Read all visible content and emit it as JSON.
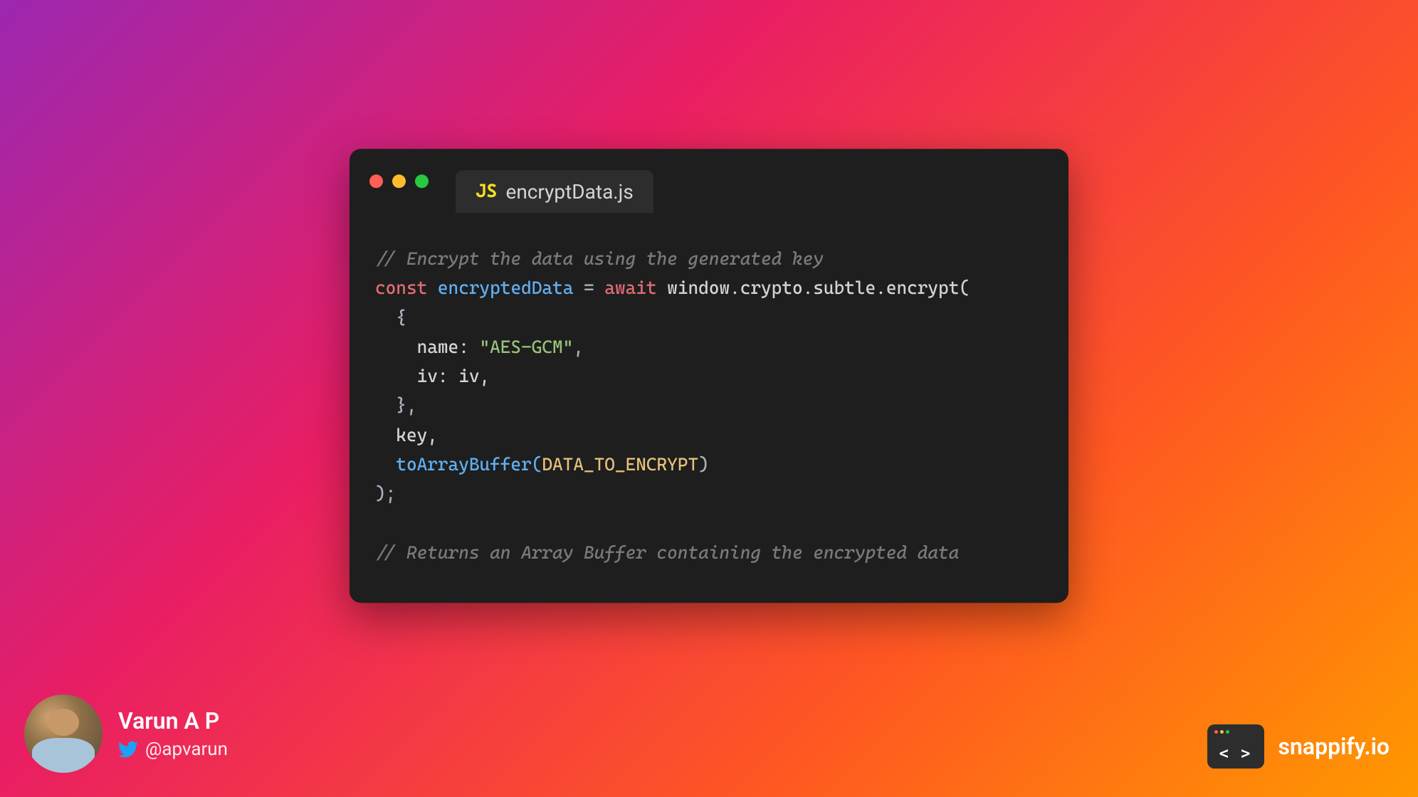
{
  "window": {
    "filename": "encryptData.js",
    "language_badge": "JS"
  },
  "code": {
    "line1_comment": "// Encrypt the data using the generated key",
    "line2_const": "const",
    "line2_var": "encryptedData",
    "line2_eq": " = ",
    "line2_await": "await",
    "line2_call": " window.crypto.subtle.encrypt(",
    "line3": "  {",
    "line4_indent": "    name: ",
    "line4_string": "\"AES-GCM\"",
    "line4_comma": ",",
    "line5": "    iv: iv,",
    "line6": "  },",
    "line7": "  key,",
    "line8_indent": "  toArrayBuffer(",
    "line8_param": "DATA_TO_ENCRYPT",
    "line8_close": ")",
    "line9": ");",
    "line10": "",
    "line11_comment": "// Returns an Array Buffer containing the encrypted data"
  },
  "author": {
    "name": "Varun A P",
    "handle": "@apvarun"
  },
  "brand": {
    "code_symbol": "< >",
    "text": "snappify.io"
  }
}
